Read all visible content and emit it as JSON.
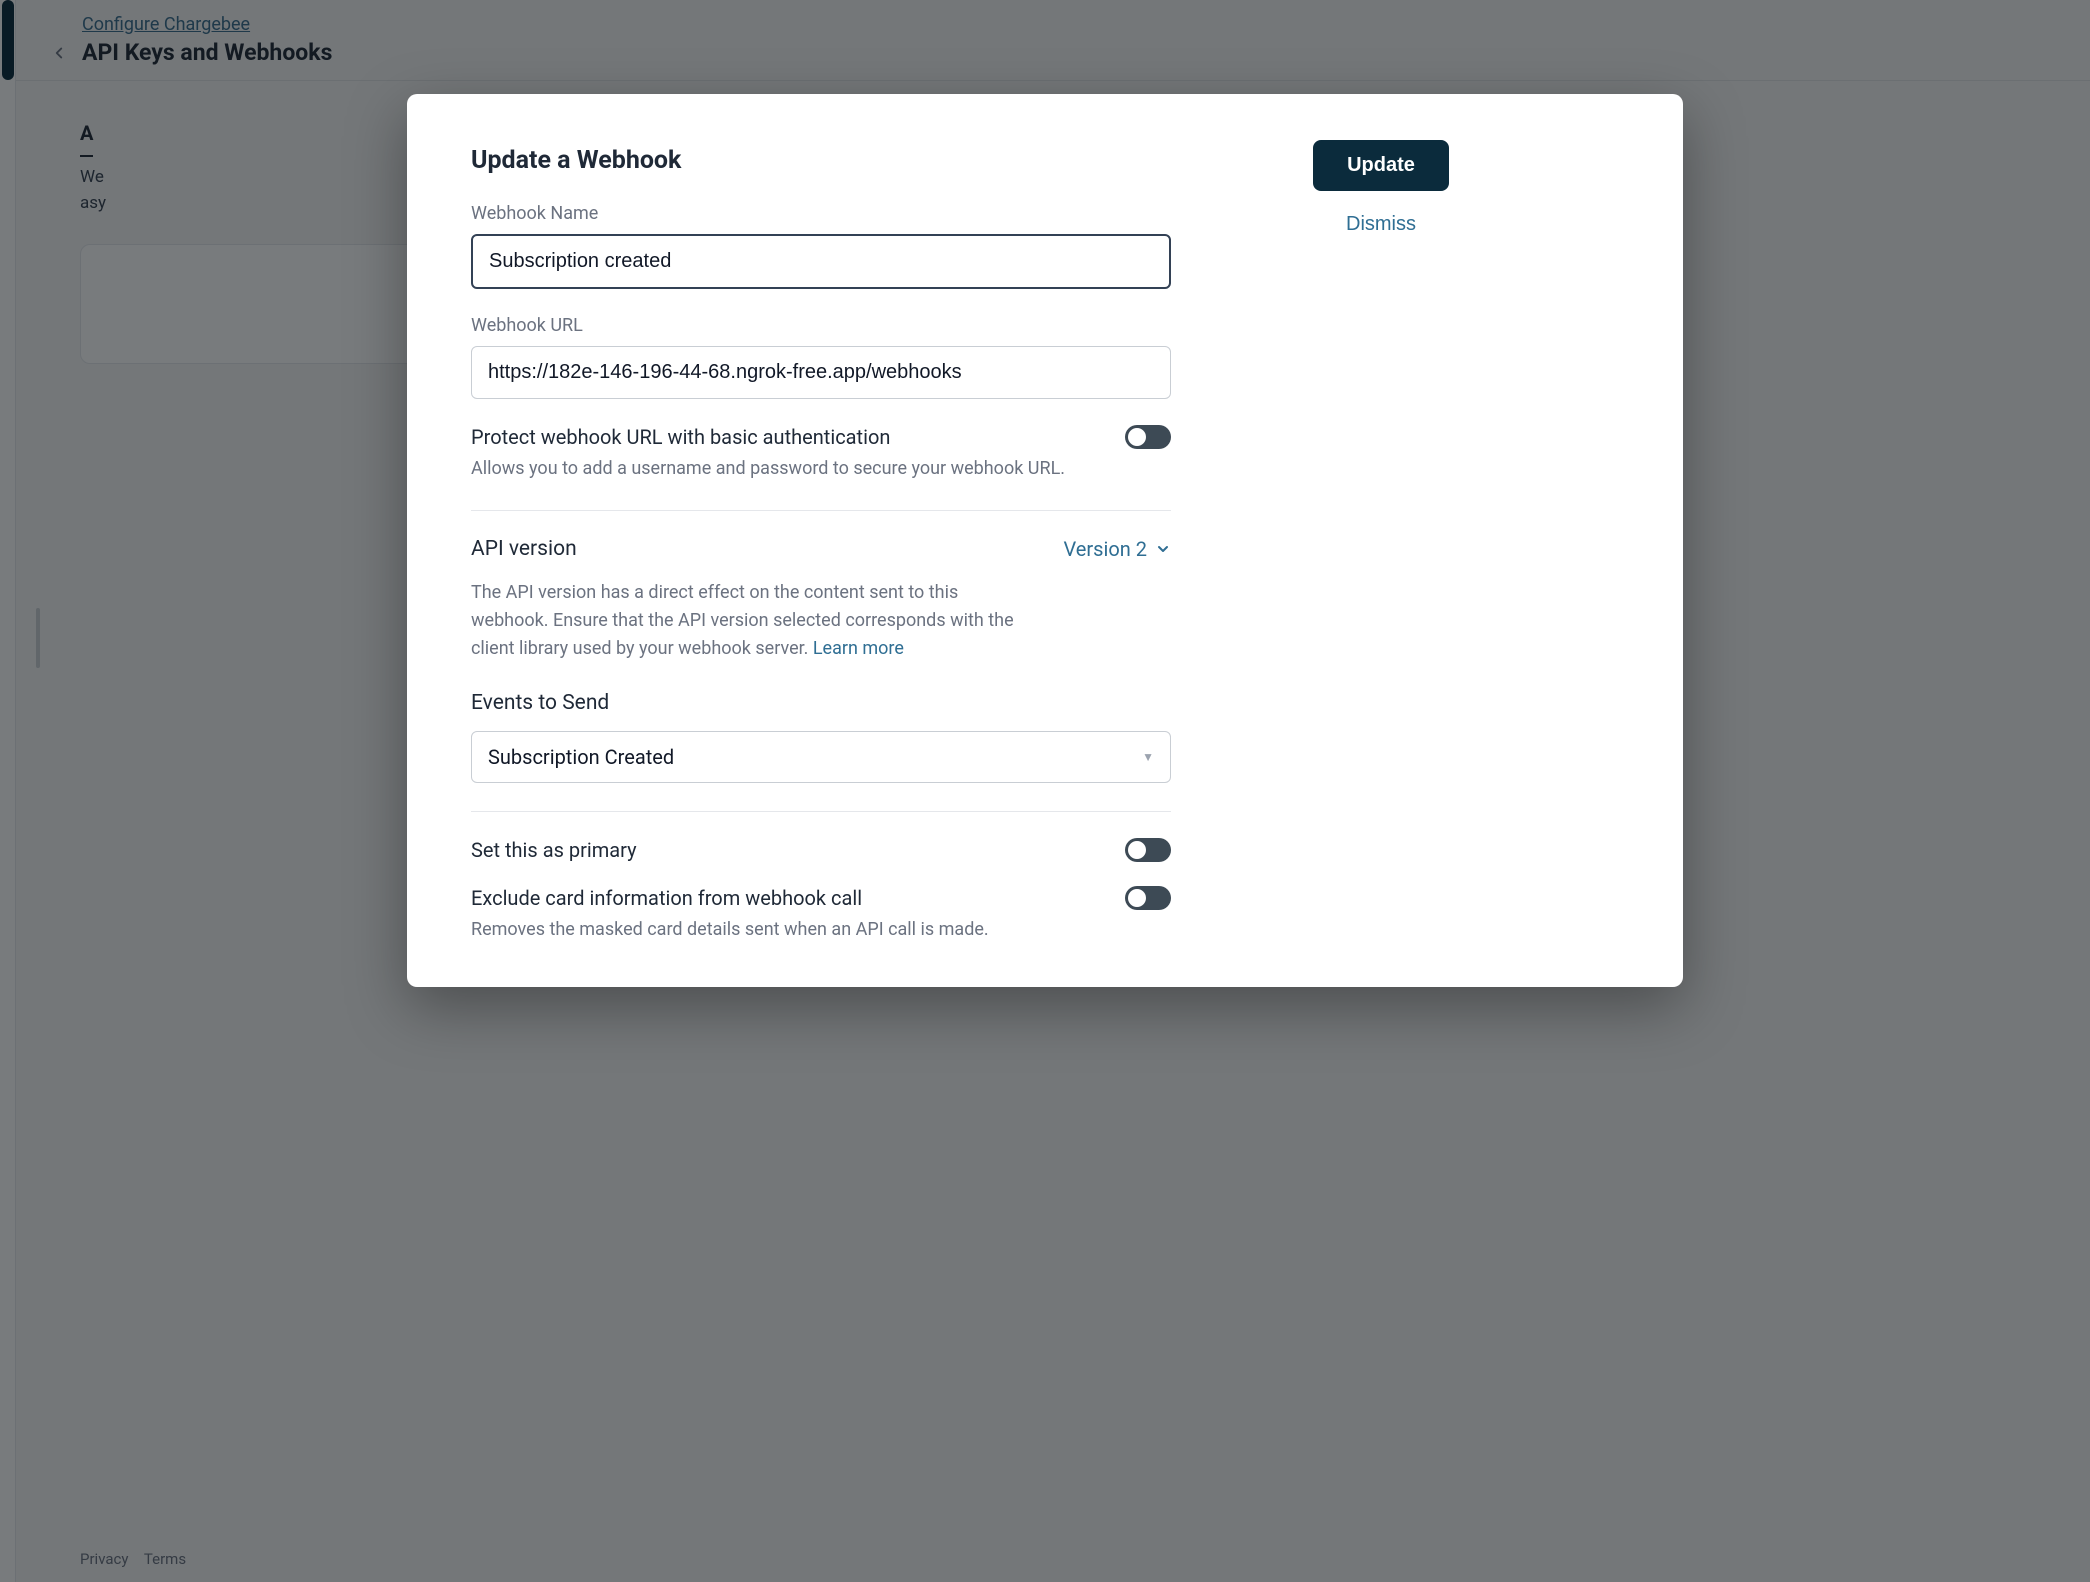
{
  "header": {
    "breadcrumb": "Configure Chargebee",
    "title": "API Keys and Webhooks"
  },
  "page": {
    "tabs": {
      "active_initial": "A"
    },
    "description_line1": "We",
    "description_line2": "asy"
  },
  "footer": {
    "privacy": "Privacy",
    "terms": "Terms"
  },
  "modal": {
    "title": "Update a Webhook",
    "actions": {
      "update": "Update",
      "dismiss": "Dismiss"
    },
    "fields": {
      "name": {
        "label": "Webhook Name",
        "value": "Subscription created"
      },
      "url": {
        "label": "Webhook URL",
        "value": "https://182e-146-196-44-68.ngrok-free.app/webhooks"
      },
      "basic_auth": {
        "title": "Protect webhook URL with basic authentication",
        "description": "Allows you to add a username and password to secure your webhook URL.",
        "enabled": false
      },
      "api_version": {
        "label": "API version",
        "selected": "Version 2",
        "description": "The API version has a direct effect on the content sent to this webhook. Ensure that the API version selected corresponds with the client library used by your webhook server. ",
        "learn_more": "Learn more"
      },
      "events": {
        "label": "Events to Send",
        "selected": "Subscription Created"
      },
      "primary": {
        "title": "Set this as primary",
        "enabled": false
      },
      "exclude_card": {
        "title": "Exclude card information from webhook call",
        "description": "Removes the masked card details sent when an API call is made.",
        "enabled": false
      }
    }
  }
}
